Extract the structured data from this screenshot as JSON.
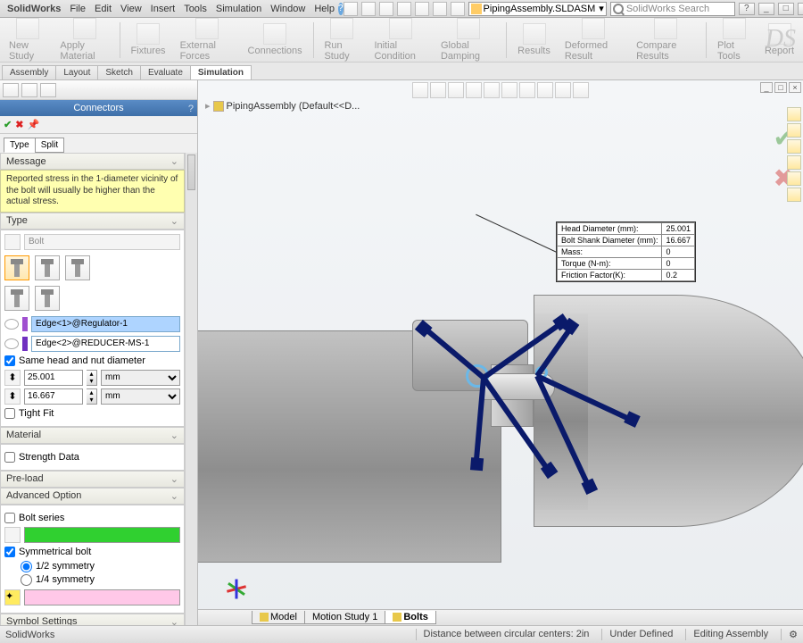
{
  "app": {
    "name": "SolidWorks",
    "menus": [
      "File",
      "Edit",
      "View",
      "Insert",
      "Tools",
      "Simulation",
      "Window",
      "Help"
    ],
    "document_name": "PipingAssembly.SLDASM",
    "search_placeholder": "SolidWorks Search"
  },
  "ribbon": {
    "groups": [
      "New Study",
      "Apply Material",
      "Fixtures",
      "External Forces",
      "Connections",
      "Run Study",
      "Initial Condition",
      "Global Damping",
      "Results",
      "Deformed Result",
      "Compare Results",
      "Plot Tools",
      "Report"
    ]
  },
  "command_tabs": {
    "tabs": [
      "Assembly",
      "Layout",
      "Sketch",
      "Evaluate",
      "Simulation"
    ],
    "active": "Simulation"
  },
  "property_manager": {
    "title": "Connectors",
    "tabs": [
      "Type",
      "Split"
    ],
    "active_tab": "Type",
    "message_header": "Message",
    "message_text": "Reported stress in the 1-diameter vicinity of the bolt will usually be higher than the actual stress.",
    "type_header": "Type",
    "connector_type": "Bolt",
    "edge1": "Edge<1>@Regulator-1",
    "edge2": "Edge<2>@REDUCER-MS-1",
    "same_head_nut": "Same head and nut diameter",
    "head_dia_value": "25.001",
    "shank_dia_value": "16.667",
    "unit": "mm",
    "tight_fit": "Tight Fit",
    "material_header": "Material",
    "strength_data": "Strength Data",
    "preload_header": "Pre-load",
    "adv_header": "Advanced Option",
    "bolt_series": "Bolt series",
    "sym_bolt": "Symmetrical bolt",
    "sym_half": "1/2 symmetry",
    "sym_quarter": "1/4 symmetry",
    "symbol_header": "Symbol Settings",
    "series_color": "#30d030",
    "symbol_color": "#ffc8e8"
  },
  "viewport": {
    "tree_label": "PipingAssembly (Default<<D..."
  },
  "callout": {
    "rows": [
      {
        "label": "Head Diameter (mm):",
        "value": "25.001"
      },
      {
        "label": "Bolt Shank Diameter (mm):",
        "value": "16.667"
      },
      {
        "label": "Mass:",
        "value": "0"
      },
      {
        "label": "Torque (N-m):",
        "value": "0"
      },
      {
        "label": "Friction Factor(K):",
        "value": "0.2"
      }
    ]
  },
  "bottom_tabs": {
    "tabs": [
      "Model",
      "Motion Study 1",
      "Bolts"
    ],
    "active": "Bolts"
  },
  "status": {
    "left": "SolidWorks",
    "cells": [
      "Distance between circular centers: 2in",
      "Under Defined",
      "Editing Assembly"
    ]
  }
}
